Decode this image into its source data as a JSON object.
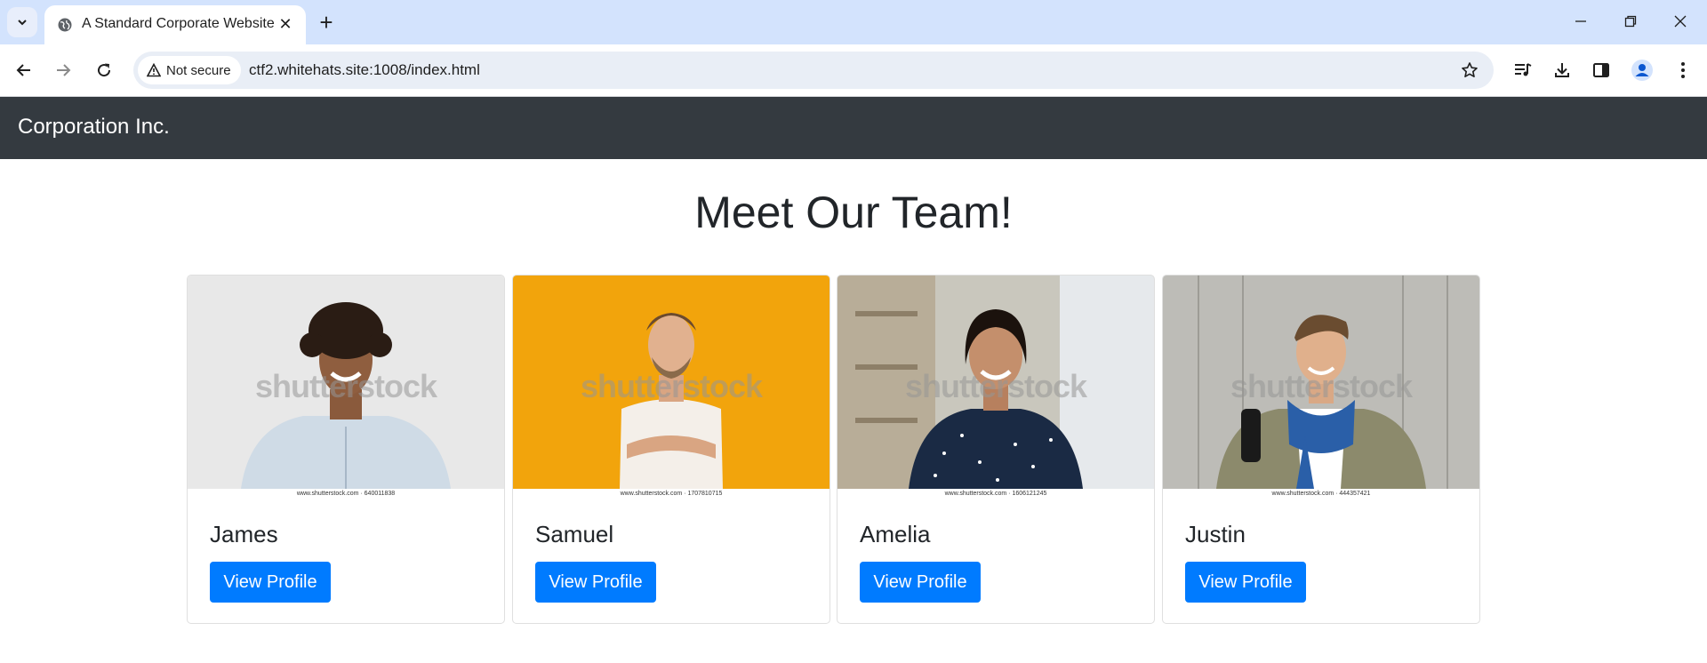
{
  "browser": {
    "tab_title": "A Standard Corporate Website",
    "security_label": "Not secure",
    "url": "ctf2.whitehats.site:1008/index.html"
  },
  "page": {
    "brand": "Corporation Inc.",
    "heading": "Meet Our Team!",
    "watermark": "shutterstock",
    "team": [
      {
        "name": "James",
        "button": "View Profile",
        "stock_id": "www.shutterstock.com · 640011838",
        "bg": "#e9e9e9"
      },
      {
        "name": "Samuel",
        "button": "View Profile",
        "stock_id": "www.shutterstock.com · 1707810715",
        "bg": "#f2a40c"
      },
      {
        "name": "Amelia",
        "button": "View Profile",
        "stock_id": "www.shutterstock.com · 1606121245",
        "bg": "#c9c7bd"
      },
      {
        "name": "Justin",
        "button": "View Profile",
        "stock_id": "www.shutterstock.com · 444357421",
        "bg": "#b9b9b4"
      }
    ]
  },
  "colors": {
    "navbar": "#343a40",
    "button": "#007bff",
    "tabbar": "#d3e3fd"
  }
}
